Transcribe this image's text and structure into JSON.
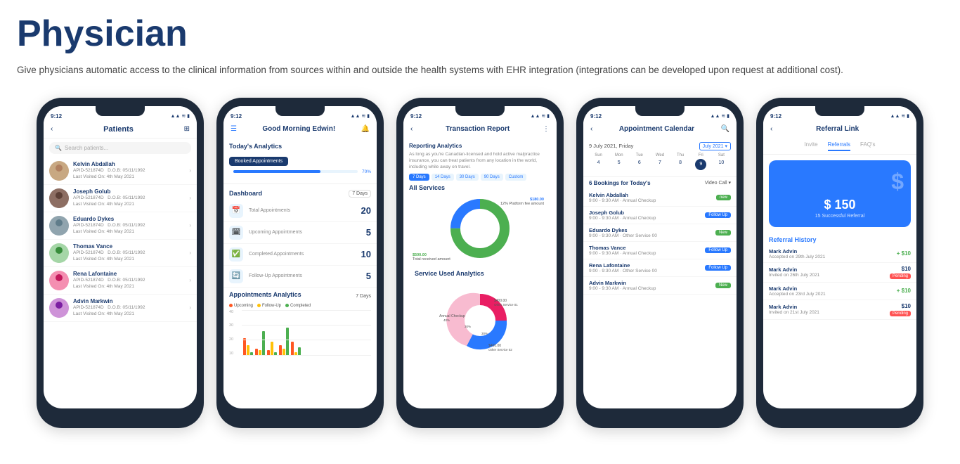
{
  "header": {
    "title": "Physician",
    "description": "Give physicians automatic access to the clinical information from sources within and outside the health systems with EHR integration (integrations can be developed upon request at additional cost)."
  },
  "phones": [
    {
      "id": "patients",
      "status_time": "9:12",
      "screen_title": "Patients",
      "search_placeholder": "Search patients...",
      "patients": [
        {
          "name": "Kelvin Abdallah",
          "id": "APID-521874D",
          "dob": "D.O.B: 05/11/1992",
          "last_visited": "Last Visited On: 4th May 2021"
        },
        {
          "name": "Joseph Golub",
          "id": "APID-521874D",
          "dob": "D.O.B: 05/11/1992",
          "last_visited": "Last Visited On: 4th May 2021"
        },
        {
          "name": "Eduardo Dykes",
          "id": "APID-521874D",
          "dob": "D.O.B: 05/11/1992",
          "last_visited": "Last Visited On: 4th May 2021"
        },
        {
          "name": "Thomas Vance",
          "id": "APID-521874D",
          "dob": "D.O.B: 05/11/1992",
          "last_visited": "Last Visited On: 4th May 2021"
        },
        {
          "name": "Rena Lafontaine",
          "id": "APID-521874D",
          "dob": "D.O.B: 05/11/1992",
          "last_visited": "Last Visited On: 4th May 2021"
        },
        {
          "name": "Advin Markwin",
          "id": "APID-521874D",
          "dob": "D.O.B: 05/11/1992",
          "last_visited": "Last Visited On: 4th May 2021"
        }
      ]
    },
    {
      "id": "dashboard",
      "status_time": "9:12",
      "greeting": "Good Morning Edwin!",
      "analytics_title": "Today's Analytics",
      "booked_label": "Booked Appointments",
      "booked_pct": "70%",
      "dashboard_title": "Dashboard",
      "days_label": "7 Days",
      "stats": [
        {
          "label": "Total Appointments",
          "value": "20"
        },
        {
          "label": "Upcoming Appointments",
          "value": "5"
        },
        {
          "label": "Completed Appointments",
          "value": "10"
        },
        {
          "label": "Follow-Up Appointments",
          "value": "5"
        }
      ],
      "appt_analytics_title": "Appointments Analytics",
      "appt_days": "7 Days",
      "legend": [
        {
          "label": "Upcoming",
          "color": "#ff5722"
        },
        {
          "label": "Follow-Up",
          "color": "#ffc107"
        },
        {
          "label": "Completed",
          "color": "#4caf50"
        }
      ],
      "chart_y_labels": [
        "40",
        "30",
        "20",
        "10"
      ]
    },
    {
      "id": "transaction",
      "status_time": "9:12",
      "screen_title": "Transaction Report",
      "reporting_title": "Reporting Analytics",
      "reporting_text": "As long as you're Canadian-licensed and hold active malpractice insurance, you can treat patients from any location in the world, including while away on travel.",
      "filters": [
        "7 Days",
        "14 Days",
        "30 Days",
        "90 Days",
        "Custom"
      ],
      "active_filter": "7 Days",
      "all_services_title": "All Services",
      "donut_label1": "$180.00",
      "donut_label2": "12% Platform fee amount",
      "donut_label3": "$500.00",
      "donut_label4": "Total received amount",
      "service_analytics_title": "Service Used Analytics"
    },
    {
      "id": "calendar",
      "status_time": "9:12",
      "screen_title": "Appointment Calendar",
      "date_label": "9 July 2021, Friday",
      "month_badge": "July 2021",
      "day_headers": [
        "Sun",
        "Mon",
        "Tue",
        "Wed",
        "Thu",
        "Fri",
        "Sat"
      ],
      "days": [
        "4",
        "5",
        "6",
        "7",
        "8",
        "9",
        "10"
      ],
      "selected_day": "9",
      "bookings_title": "6 Bookings for Today's",
      "video_call": "Video Call",
      "bookings": [
        {
          "name": "Kelvin Abdallah",
          "time": "9:00 - 9:30 AM · Annual Checkup",
          "badge": "new",
          "badge_color": "#4caf50"
        },
        {
          "name": "Joseph Golub",
          "time": "9:00 - 9:30 AM · Annual Checkup",
          "badge": "Follow Up",
          "badge_color": "#2979ff"
        },
        {
          "name": "Eduardo Dykes",
          "time": "9:00 - 9:30 AM · Other Service 00",
          "badge": "New",
          "badge_color": "#4caf50"
        },
        {
          "name": "Thomas Vance",
          "time": "9:00 - 9:30 AM · Annual Checkup",
          "badge": "Follow Up",
          "badge_color": "#2979ff"
        },
        {
          "name": "Rena Lafontaine",
          "time": "9:00 - 9:30 AM · Other Service 00",
          "badge": "Follow Up",
          "badge_color": "#2979ff"
        },
        {
          "name": "Advin Markwin",
          "time": "9:00 - 9:30 AM · Annual Checkup",
          "badge": "New",
          "badge_color": "#4caf50"
        }
      ]
    },
    {
      "id": "referral",
      "status_time": "9:12",
      "screen_title": "Referral Link",
      "tabs": [
        "Invite",
        "Referrals",
        "FAQ's"
      ],
      "active_tab": "Referrals",
      "amount": "$ 150",
      "referral_subtitle": "15 Successful Referral",
      "history_title": "Referral History",
      "history_items": [
        {
          "name": "Mark Advin",
          "date": "Accepted on 29th July 2021",
          "amount": "+ $10",
          "type": "positive"
        },
        {
          "name": "Mark Advin",
          "date": "Invited on 26th July 2021",
          "amount": "$10",
          "badge": "Pending",
          "type": "pending"
        },
        {
          "name": "Mark Advin",
          "date": "Accepted on 23rd July 2021",
          "amount": "+ $10",
          "type": "positive"
        },
        {
          "name": "Mark Advin",
          "date": "Invited on 21st July 2021",
          "amount": "$10",
          "badge": "Pending",
          "type": "pending"
        }
      ]
    }
  ]
}
